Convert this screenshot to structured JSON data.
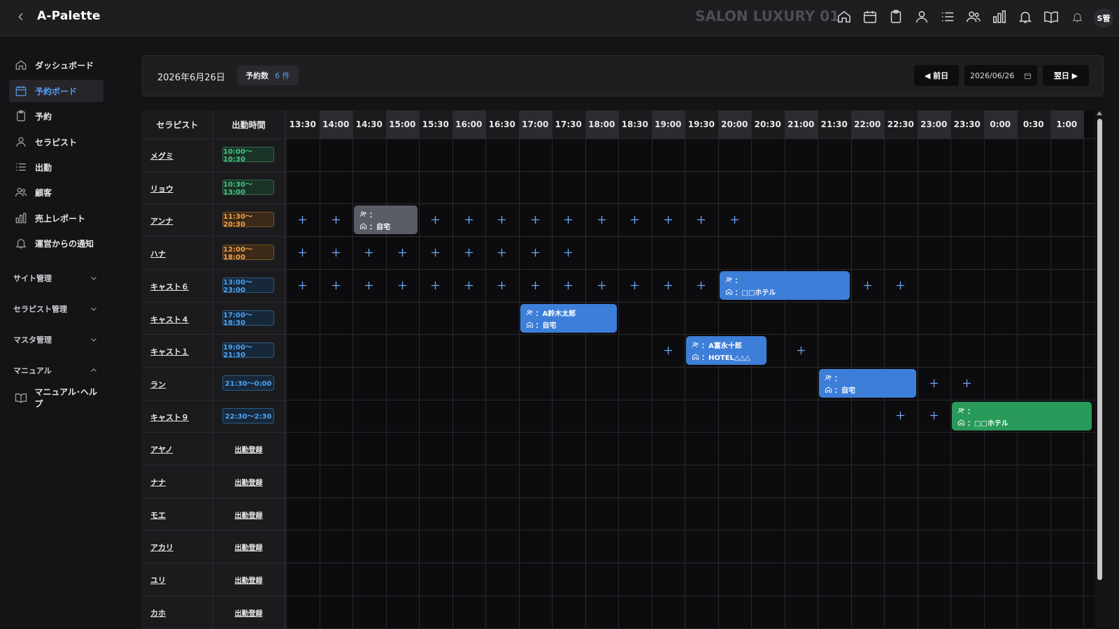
{
  "app": {
    "title": "A-Palette",
    "salon_name": "SALON LUXURY 01",
    "user_avatar": "S管"
  },
  "top_icons": [
    "home-icon",
    "calendar-icon",
    "clipboard-icon",
    "person-icon",
    "list-icon",
    "users-icon",
    "bar-chart-icon",
    "bell-icon",
    "book-icon",
    "bell-small-icon"
  ],
  "sidebar": {
    "items": [
      {
        "label": "ダッシュボード",
        "icon": "home-icon",
        "active": false
      },
      {
        "label": "予約ボード",
        "icon": "calendar-icon",
        "active": true
      },
      {
        "label": "予約",
        "icon": "clipboard-icon",
        "active": false
      },
      {
        "label": "セラピスト",
        "icon": "person-icon",
        "active": false
      },
      {
        "label": "出勤",
        "icon": "list-icon",
        "active": false
      },
      {
        "label": "顧客",
        "icon": "users-icon",
        "active": false
      },
      {
        "label": "売上レポート",
        "icon": "bar-chart-icon",
        "active": false
      },
      {
        "label": "運営からの通知",
        "icon": "bell-icon",
        "active": false
      }
    ],
    "sections": [
      {
        "label": "サイト管理",
        "expanded": false
      },
      {
        "label": "セラピスト管理",
        "expanded": false
      },
      {
        "label": "マスタ管理",
        "expanded": false
      },
      {
        "label": "マニュアル",
        "expanded": true
      }
    ],
    "manual_item": {
      "label": "マニュアル･ヘルプ",
      "icon": "book-icon"
    }
  },
  "date_bar": {
    "current_date": "2026年6月26日",
    "reservation_count_label": "予約数",
    "reservation_count": "6 件",
    "prev_label": "◀ 前日",
    "date_value": "2026/06/26",
    "next_label": "翌日 ▶"
  },
  "board": {
    "col_therapist": "セラピスト",
    "col_shift": "出勤時間",
    "times": [
      "13:30",
      "14:00",
      "14:30",
      "15:00",
      "15:30",
      "16:00",
      "16:30",
      "17:00",
      "17:30",
      "18:00",
      "18:30",
      "19:00",
      "19:30",
      "20:00",
      "20:30",
      "21:00",
      "21:30",
      "22:00",
      "22:30",
      "23:00",
      "23:30",
      "0:00",
      "0:30",
      "1:00"
    ],
    "register_label": "出勤登録",
    "rows": [
      {
        "name": "メグミ",
        "shift": "10:00〜10:30",
        "shift_color": "green",
        "plus": []
      },
      {
        "name": "リョウ",
        "shift": "10:30〜13:00",
        "shift_color": "green",
        "plus": []
      },
      {
        "name": "アンナ",
        "shift": "11:30〜20:30",
        "shift_color": "orange",
        "plus": [
          0,
          1,
          4,
          5,
          6,
          7,
          8,
          9,
          10,
          11,
          12,
          13
        ]
      },
      {
        "name": "ハナ",
        "shift": "12:00〜18:00",
        "shift_color": "orange",
        "plus": [
          0,
          1,
          2,
          3,
          4,
          5,
          6,
          7,
          8
        ]
      },
      {
        "name": "キャスト６",
        "shift": "13:00〜23:00",
        "shift_color": "blue",
        "plus": [
          0,
          1,
          2,
          3,
          4,
          5,
          6,
          7,
          8,
          9,
          10,
          11,
          12,
          17,
          18
        ]
      },
      {
        "name": "キャスト４",
        "shift": "17:00〜18:30",
        "shift_color": "blue",
        "plus": []
      },
      {
        "name": "キャスト１",
        "shift": "19:00〜21:30",
        "shift_color": "blue",
        "plus": [
          11,
          15
        ]
      },
      {
        "name": "ラン",
        "shift": "21:30〜0:00",
        "shift_color": "blue",
        "plus": [
          19,
          20
        ]
      },
      {
        "name": "キャスト９",
        "shift": "22:30〜2:30",
        "shift_color": "blue",
        "plus": [
          18,
          19
        ]
      },
      {
        "name": "アヤノ",
        "shift": null,
        "plus": []
      },
      {
        "name": "ナナ",
        "shift": null,
        "plus": []
      },
      {
        "name": "モエ",
        "shift": null,
        "plus": []
      },
      {
        "name": "アカリ",
        "shift": null,
        "plus": []
      },
      {
        "name": "ユリ",
        "shift": null,
        "plus": []
      },
      {
        "name": "カホ",
        "shift": null,
        "plus": []
      }
    ],
    "bookings": [
      {
        "row": 2,
        "start": 2,
        "span": 2,
        "customer": "：",
        "place": "：自宅",
        "color": "gray"
      },
      {
        "row": 4,
        "start": 13,
        "span": 4,
        "customer": "：",
        "place": "：□□ホテル",
        "color": "blue"
      },
      {
        "row": 5,
        "start": 7,
        "span": 3,
        "customer": "：A鈴木太郎",
        "place": "：自宅",
        "color": "blue"
      },
      {
        "row": 6,
        "start": 12,
        "span": 2.5,
        "customer": "：A富永十郎",
        "place": "：HOTEL△△△",
        "color": "blue"
      },
      {
        "row": 7,
        "start": 16,
        "span": 3,
        "customer": "：",
        "place": "：自宅",
        "color": "blue"
      },
      {
        "row": 8,
        "start": 20,
        "span": 4.3,
        "customer": "：",
        "place": "：□□ホテル",
        "color": "green"
      }
    ]
  },
  "colors": {
    "accent": "#5b9cf2",
    "booking_blue": "#3d7ed8",
    "booking_green": "#2a9a5b",
    "booking_gray": "#5a5d66"
  }
}
